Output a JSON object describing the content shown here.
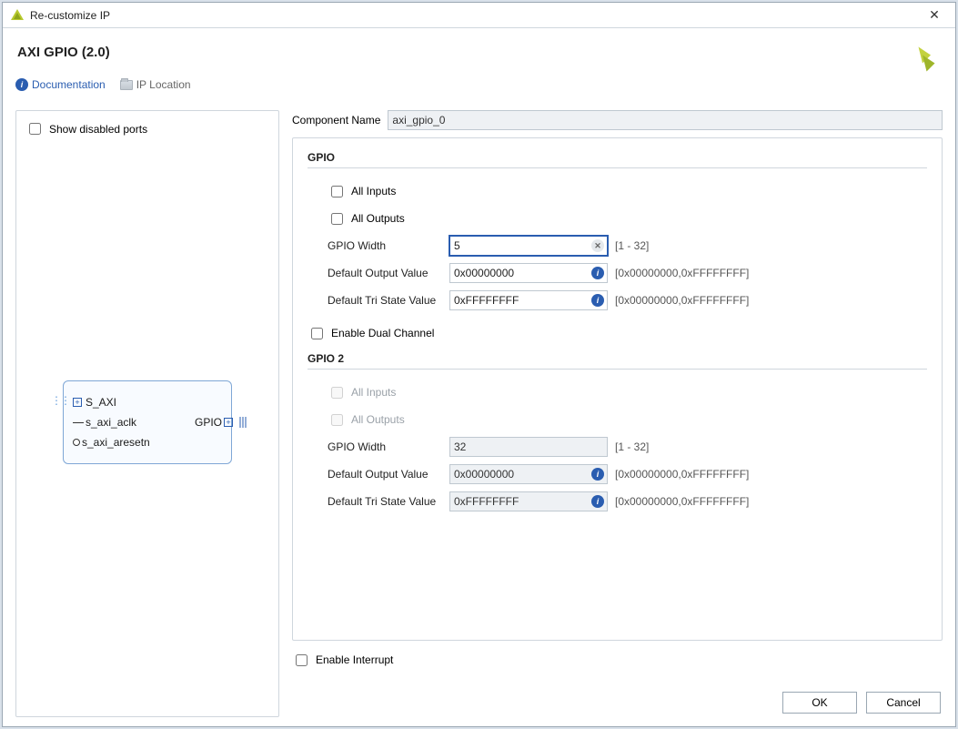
{
  "window": {
    "title": "Re-customize IP"
  },
  "ip_title": "AXI GPIO (2.0)",
  "toolbar": {
    "documentation": "Documentation",
    "ip_location": "IP Location"
  },
  "preview": {
    "show_disabled_label": "Show disabled ports",
    "ports": {
      "s_axi": "S_AXI",
      "aclk": "s_axi_aclk",
      "aresetn": "s_axi_aresetn",
      "gpio": "GPIO"
    }
  },
  "component_name": {
    "label": "Component Name",
    "value": "axi_gpio_0"
  },
  "gpio": {
    "heading": "GPIO",
    "all_inputs": "All Inputs",
    "all_outputs": "All Outputs",
    "width_label": "GPIO Width",
    "width_value": "5",
    "width_range": "[1 - 32]",
    "default_out_label": "Default Output Value",
    "default_out_value": "0x00000000",
    "default_tri_label": "Default Tri State Value",
    "default_tri_value": "0xFFFFFFFF",
    "hex_range": "[0x00000000,0xFFFFFFFF]",
    "enable_dual": "Enable Dual Channel"
  },
  "gpio2": {
    "heading": "GPIO 2",
    "all_inputs": "All Inputs",
    "all_outputs": "All Outputs",
    "width_label": "GPIO Width",
    "width_value": "32",
    "width_range": "[1 - 32]",
    "default_out_label": "Default Output Value",
    "default_out_value": "0x00000000",
    "default_tri_label": "Default Tri State Value",
    "default_tri_value": "0xFFFFFFFF",
    "hex_range": "[0x00000000,0xFFFFFFFF]"
  },
  "enable_interrupt": "Enable Interrupt",
  "buttons": {
    "ok": "OK",
    "cancel": "Cancel"
  }
}
